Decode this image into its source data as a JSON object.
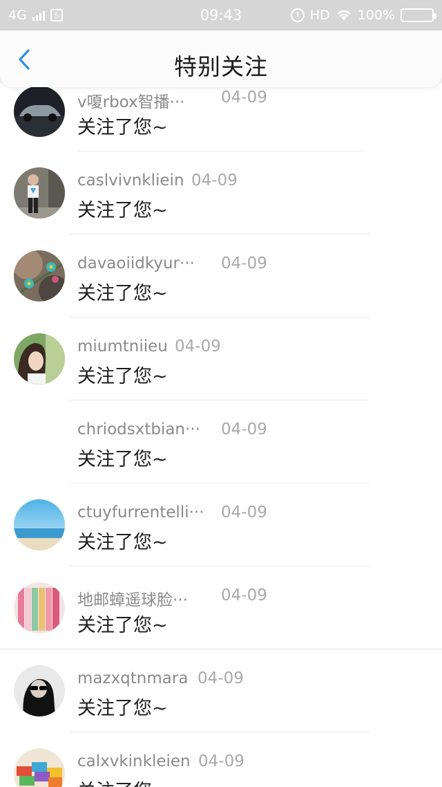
{
  "status_bar": {
    "network": "4G",
    "sim_label": "S",
    "time": "09:43",
    "hd": "HD",
    "battery": "100%"
  },
  "nav": {
    "title": "特别关注"
  },
  "items": [
    {
      "name": "v嗄rbox智播···",
      "date": "04-09",
      "message": "关注了您~",
      "avatar_icon": "car-avatar"
    },
    {
      "name": "caslvivnkliein",
      "date": "04-09",
      "message": "关注了您~",
      "avatar_icon": "person-street-avatar"
    },
    {
      "name": "davaoiidkyur···",
      "date": "04-09",
      "message": "关注了您~",
      "avatar_icon": "flowers-avatar"
    },
    {
      "name": "miumtniieu",
      "date": "04-09",
      "message": "关注了您~",
      "avatar_icon": "woman-portrait-avatar"
    },
    {
      "name": "chriodsxtbian···",
      "date": "04-09",
      "message": "关注了您~",
      "avatar_icon": "no-avatar"
    },
    {
      "name": "ctuyfurrentelli···",
      "date": "04-09",
      "message": "关注了您~",
      "avatar_icon": "beach-avatar"
    },
    {
      "name": "地邮蟑遥球脸···",
      "date": "04-09",
      "message": "关注了您~",
      "avatar_icon": "books-avatar"
    },
    {
      "name": "mazxqtnmara",
      "date": "04-09",
      "message": "关注了您~",
      "avatar_icon": "sunglasses-portrait-avatar"
    },
    {
      "name": "calxvkinkleien",
      "date": "04-09",
      "message": "关注了您~",
      "avatar_icon": "colorful-blocks-avatar"
    }
  ],
  "colors": {
    "accent_blue": "#2a8ee6",
    "status_bar_bg": "#d6d6d6"
  }
}
